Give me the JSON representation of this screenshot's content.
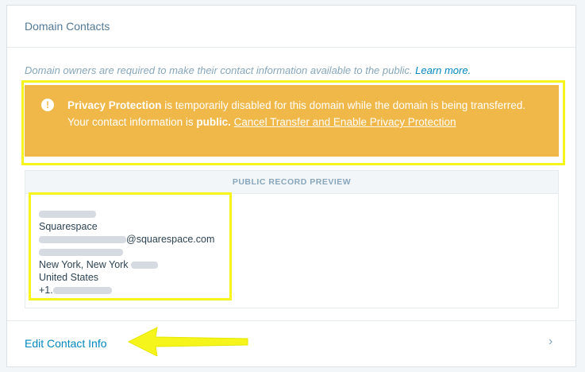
{
  "header": {
    "title": "Domain Contacts"
  },
  "intro": {
    "text": "Domain owners are required to make their contact information available to the public.",
    "link": "Learn more."
  },
  "notice": {
    "icon": "exclamation-icon",
    "bold1": "Privacy Protection",
    "text1": " is temporarily disabled for this domain while the domain is being transferred. Your contact information is ",
    "bold2": "public.",
    "link": "Cancel Transfer and Enable Privacy Protection"
  },
  "preview": {
    "heading": "PUBLIC RECORD PREVIEW",
    "company": "Squarespace",
    "email_suffix": "@squarespace.com",
    "city": "New York, New York",
    "country": "United States",
    "phone_prefix": "+1."
  },
  "footer": {
    "link": "Edit Contact Info",
    "chevron": "›"
  },
  "colors": {
    "accent": "#0087be",
    "notice_bg": "#f0b849",
    "highlight": "#f5f51b"
  }
}
